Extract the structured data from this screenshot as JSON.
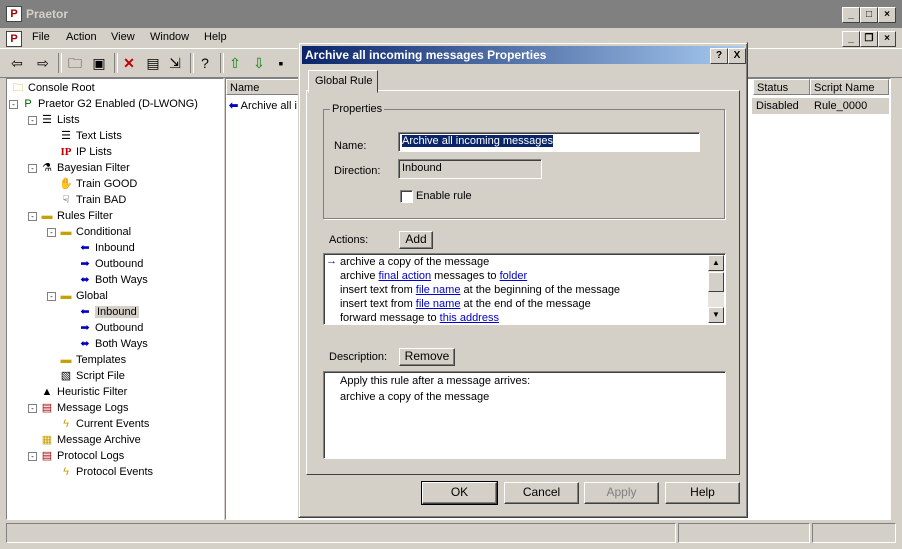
{
  "app": {
    "title": "Praetor",
    "icon": "praetor-p-icon"
  },
  "menu": [
    "File",
    "Action",
    "View",
    "Window",
    "Help"
  ],
  "tree": {
    "nodes": [
      {
        "label": "Console Root",
        "icon": "folder-icon"
      },
      {
        "label": "Praetor G2 Enabled (D-LWONG)",
        "icon": "praetor-server-icon"
      },
      {
        "label": "Lists",
        "icon": "scroll-icon"
      },
      {
        "label": "Text Lists",
        "icon": "scroll-icon"
      },
      {
        "label": "IP Lists",
        "icon": "ip-icon",
        "icon_text": "IP"
      },
      {
        "label": "Bayesian Filter",
        "icon": "filter-icon"
      },
      {
        "label": "Train GOOD",
        "icon": "train-good-icon"
      },
      {
        "label": "Train BAD",
        "icon": "train-bad-icon"
      },
      {
        "label": "Rules Filter",
        "icon": "rules-icon"
      },
      {
        "label": "Conditional",
        "icon": "rules-icon"
      },
      {
        "label": "Inbound",
        "icon": "arrow-left-icon"
      },
      {
        "label": "Outbound",
        "icon": "arrow-right-icon"
      },
      {
        "label": "Both Ways",
        "icon": "arrow-both-icon"
      },
      {
        "label": "Global",
        "icon": "rules-icon"
      },
      {
        "label": "Inbound",
        "icon": "arrow-left-icon"
      },
      {
        "label": "Outbound",
        "icon": "arrow-right-icon"
      },
      {
        "label": "Both Ways",
        "icon": "arrow-both-icon"
      },
      {
        "label": "Templates",
        "icon": "rules-icon"
      },
      {
        "label": "Script File",
        "icon": "script-icon"
      },
      {
        "label": "Heuristic Filter",
        "icon": "heuristic-icon"
      },
      {
        "label": "Message Logs",
        "icon": "log-icon"
      },
      {
        "label": "Current Events",
        "icon": "lightning-icon"
      },
      {
        "label": "Message Archive",
        "icon": "archive-icon"
      },
      {
        "label": "Protocol Logs",
        "icon": "log-icon"
      },
      {
        "label": "Protocol Events",
        "icon": "lightning-icon"
      }
    ],
    "selected": "Inbound"
  },
  "list": {
    "columns": {
      "name": "Name",
      "status": "Status",
      "script": "Script Name"
    },
    "rows": [
      {
        "name": "Archive all i",
        "status": "Disabled",
        "script": "Rule_0000"
      }
    ]
  },
  "dialog": {
    "title": "Archive all incoming messages Properties",
    "help_btn": "?",
    "close_btn": "X",
    "tab": "Global Rule",
    "properties_label": "Properties",
    "name_label": "Name:",
    "name_value": "Archive all incoming messages",
    "direction_label": "Direction:",
    "direction_value": "Inbound",
    "enable_label": "Enable rule",
    "enable_checked": false,
    "actions_label": "Actions:",
    "add_btn": "Add",
    "actions": [
      [
        {
          "t": "archive a copy of the message"
        }
      ],
      [
        {
          "t": "archive "
        },
        {
          "t": "final action",
          "link": true
        },
        {
          "t": " messages to "
        },
        {
          "t": "folder",
          "link": true
        }
      ],
      [
        {
          "t": "insert text from "
        },
        {
          "t": "file name",
          "link": true
        },
        {
          "t": " at the beginning of the message"
        }
      ],
      [
        {
          "t": "insert text from "
        },
        {
          "t": "file name",
          "link": true
        },
        {
          "t": " at the end of the message"
        }
      ],
      [
        {
          "t": "forward message to "
        },
        {
          "t": "this address",
          "link": true
        }
      ]
    ],
    "description_label": "Description:",
    "remove_btn": "Remove",
    "description_lines": [
      "Apply this rule after a message arrives:",
      "archive a copy of the message"
    ],
    "ok_btn": "OK",
    "cancel_btn": "Cancel",
    "apply_btn": "Apply",
    "help_button": "Help"
  }
}
